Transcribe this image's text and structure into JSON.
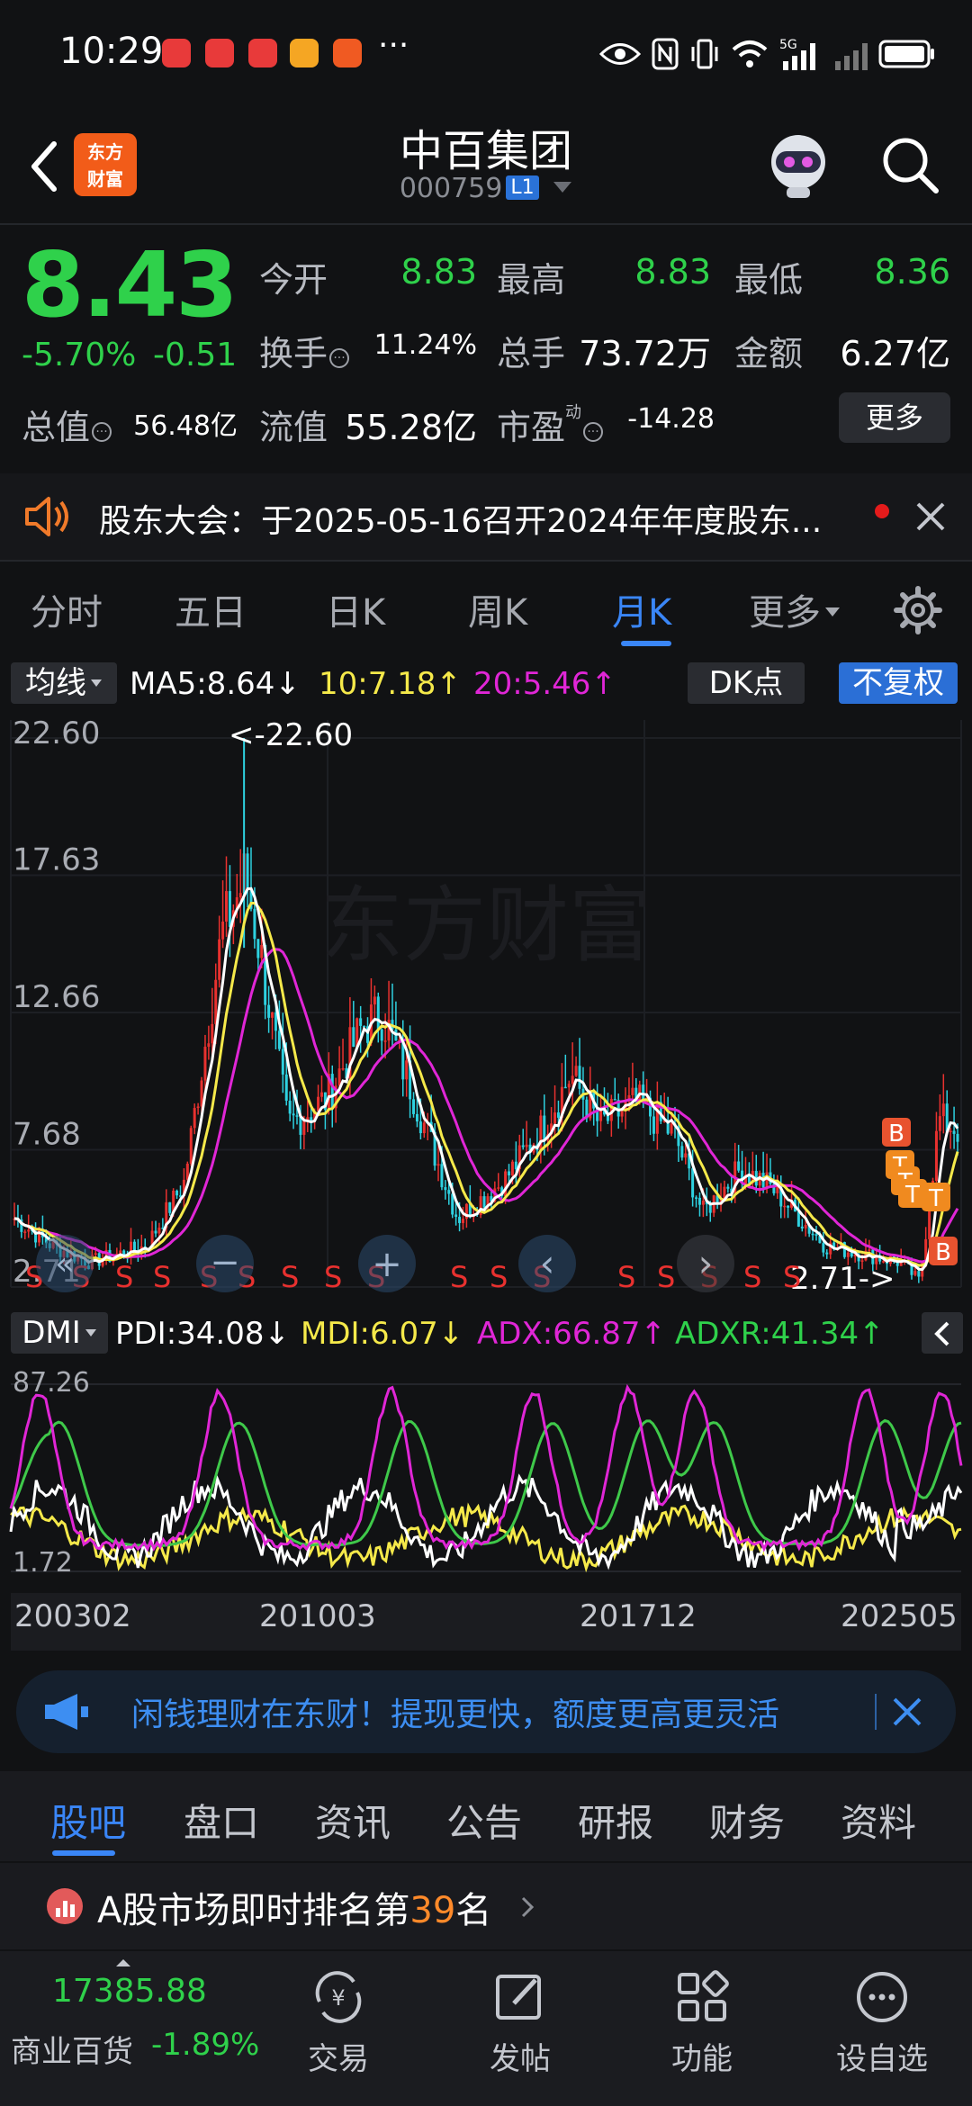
{
  "status_bar": {
    "time": "10:29",
    "dots": "···",
    "network": "5G"
  },
  "header": {
    "brand_logo_line1": "东方",
    "brand_logo_line2": "财富",
    "stock_name": "中百集团",
    "stock_code": "000759",
    "level_badge": "L1"
  },
  "quote": {
    "price": "8.43",
    "change_pct": "-5.70%",
    "change": "-0.51",
    "open_label": "今开",
    "open": "8.83",
    "high_label": "最高",
    "high": "8.83",
    "low_label": "最低",
    "low": "8.36",
    "turnover_label": "换手",
    "turnover": "11.24%",
    "volume_label": "总手",
    "volume": "73.72万",
    "amount_label": "金额",
    "amount": "6.27亿",
    "mktcap_label": "总值",
    "mktcap": "56.48亿",
    "float_label": "流值",
    "float_cap": "55.28亿",
    "pe_label": "市盈",
    "pe_sup": "动",
    "pe": "-14.28",
    "more_label": "更多"
  },
  "notice": {
    "text": "股东大会：于2025-05-16召开2024年年度股东..."
  },
  "period_tabs": {
    "items": [
      "分时",
      "五日",
      "日K",
      "周K",
      "月K",
      "更多"
    ],
    "active": "月K"
  },
  "ma_legend": {
    "selector": "均线",
    "ma5": "MA5:8.64↓",
    "ma10": "10:7.18↑",
    "ma20": "20:5.46↑",
    "dk": "DK点",
    "adjust": "不复权"
  },
  "kline_chart": {
    "y_ticks": [
      "22.60",
      "17.63",
      "12.66",
      "7.68",
      "2.71"
    ],
    "max_label": "<-22.60",
    "min_label": "2.71->",
    "signal_letter": "S",
    "marker_labels": [
      "B",
      "T",
      "T",
      "T",
      "T",
      "B"
    ],
    "nav_left": "«",
    "nav_zoom_out": "−",
    "nav_zoom_in": "+",
    "nav_prev": "‹",
    "nav_next": "›"
  },
  "dmi_legend": {
    "selector": "DMI",
    "pdi": "PDI:34.08↓",
    "mdi": "MDI:6.07↓",
    "adx": "ADX:66.87↑",
    "adxr": "ADXR:41.34↑"
  },
  "dmi_chart": {
    "y_top": "87.26",
    "y_bottom": "1.72"
  },
  "date_axis": [
    "200302",
    "201003",
    "201712",
    "202505"
  ],
  "promo": {
    "text": "闲钱理财在东财！提现更快，额度更高更灵活"
  },
  "section_tabs": {
    "items": [
      "股吧",
      "盘口",
      "资讯",
      "公告",
      "研报",
      "财务",
      "资料"
    ],
    "active": "股吧"
  },
  "ranking": {
    "prefix": "A股市场即时排名第",
    "rank": "39",
    "suffix": "名"
  },
  "bottom_nav": {
    "index_value": "17385.88",
    "index_name": "商业百货",
    "index_pct": "-1.89%",
    "items": [
      "交易",
      "发帖",
      "功能",
      "设自选"
    ]
  },
  "colors": {
    "accent_blue": "#3a86f7",
    "down_green": "#2fd14b",
    "up_red": "#e8312f",
    "ma5_white": "#ffffff",
    "ma10_yellow": "#f5e94a",
    "ma20_magenta": "#e026d6",
    "candle_cyan": "#2ed1e0"
  },
  "chart_data": {
    "type": "candlestick",
    "title": "",
    "period": "monthly",
    "x_range": [
      "200302",
      "202505"
    ],
    "ylim": [
      2.71,
      22.6
    ],
    "max_price": 22.6,
    "min_price": 2.71,
    "ma": {
      "MA5": 8.64,
      "MA10": 7.18,
      "MA20": 5.46
    },
    "indicator": {
      "name": "DMI",
      "PDI": 34.08,
      "MDI": 6.07,
      "ADX": 66.87,
      "ADXR": 41.34,
      "ylim": [
        1.72,
        87.26
      ]
    }
  }
}
